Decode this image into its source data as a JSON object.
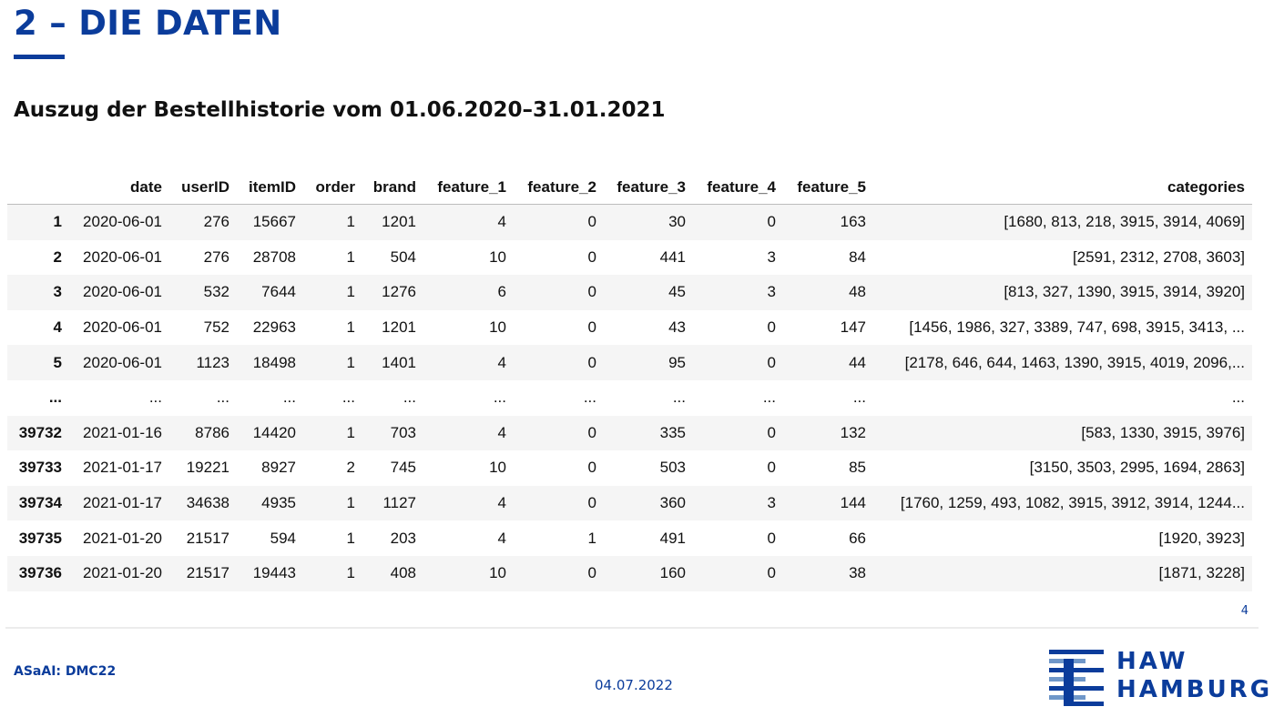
{
  "slide": {
    "title": "2 – DIE DATEN",
    "subtitle": "Auszug der Bestellhistorie vom 01.06.2020–31.01.2021",
    "page_number": "4"
  },
  "table": {
    "columns": [
      "",
      "date",
      "userID",
      "itemID",
      "order",
      "brand",
      "feature_1",
      "feature_2",
      "feature_3",
      "feature_4",
      "feature_5",
      "categories"
    ],
    "rows": [
      [
        "1",
        "2020-06-01",
        "276",
        "15667",
        "1",
        "1201",
        "4",
        "0",
        "30",
        "0",
        "163",
        "[1680, 813, 218, 3915, 3914, 4069]"
      ],
      [
        "2",
        "2020-06-01",
        "276",
        "28708",
        "1",
        "504",
        "10",
        "0",
        "441",
        "3",
        "84",
        "[2591, 2312, 2708, 3603]"
      ],
      [
        "3",
        "2020-06-01",
        "532",
        "7644",
        "1",
        "1276",
        "6",
        "0",
        "45",
        "3",
        "48",
        "[813, 327, 1390, 3915, 3914, 3920]"
      ],
      [
        "4",
        "2020-06-01",
        "752",
        "22963",
        "1",
        "1201",
        "10",
        "0",
        "43",
        "0",
        "147",
        "[1456, 1986, 327, 3389, 747, 698, 3915, 3413, ..."
      ],
      [
        "5",
        "2020-06-01",
        "1123",
        "18498",
        "1",
        "1401",
        "4",
        "0",
        "95",
        "0",
        "44",
        "[2178, 646, 644, 1463, 1390, 3915, 4019, 2096,..."
      ],
      [
        "...",
        "...",
        "...",
        "...",
        "...",
        "...",
        "...",
        "...",
        "...",
        "...",
        "...",
        "..."
      ],
      [
        "39732",
        "2021-01-16",
        "8786",
        "14420",
        "1",
        "703",
        "4",
        "0",
        "335",
        "0",
        "132",
        "[583, 1330, 3915, 3976]"
      ],
      [
        "39733",
        "2021-01-17",
        "19221",
        "8927",
        "2",
        "745",
        "10",
        "0",
        "503",
        "0",
        "85",
        "[3150, 3503, 2995, 1694, 2863]"
      ],
      [
        "39734",
        "2021-01-17",
        "34638",
        "4935",
        "1",
        "1127",
        "4",
        "0",
        "360",
        "3",
        "144",
        "[1760, 1259, 493, 1082, 3915, 3912, 3914, 1244..."
      ],
      [
        "39735",
        "2021-01-20",
        "21517",
        "594",
        "1",
        "203",
        "4",
        "1",
        "491",
        "0",
        "66",
        "[1920, 3923]"
      ],
      [
        "39736",
        "2021-01-20",
        "21517",
        "19443",
        "1",
        "408",
        "10",
        "0",
        "160",
        "0",
        "38",
        "[1871, 3228]"
      ]
    ]
  },
  "footer": {
    "left": "ASaAI: DMC22",
    "date": "04.07.2022",
    "logo_line1": "HAW",
    "logo_line2": "HAMBURG"
  },
  "colors": {
    "brand_blue": "#0b3c9b",
    "row_stripe": "#f5f5f5"
  }
}
